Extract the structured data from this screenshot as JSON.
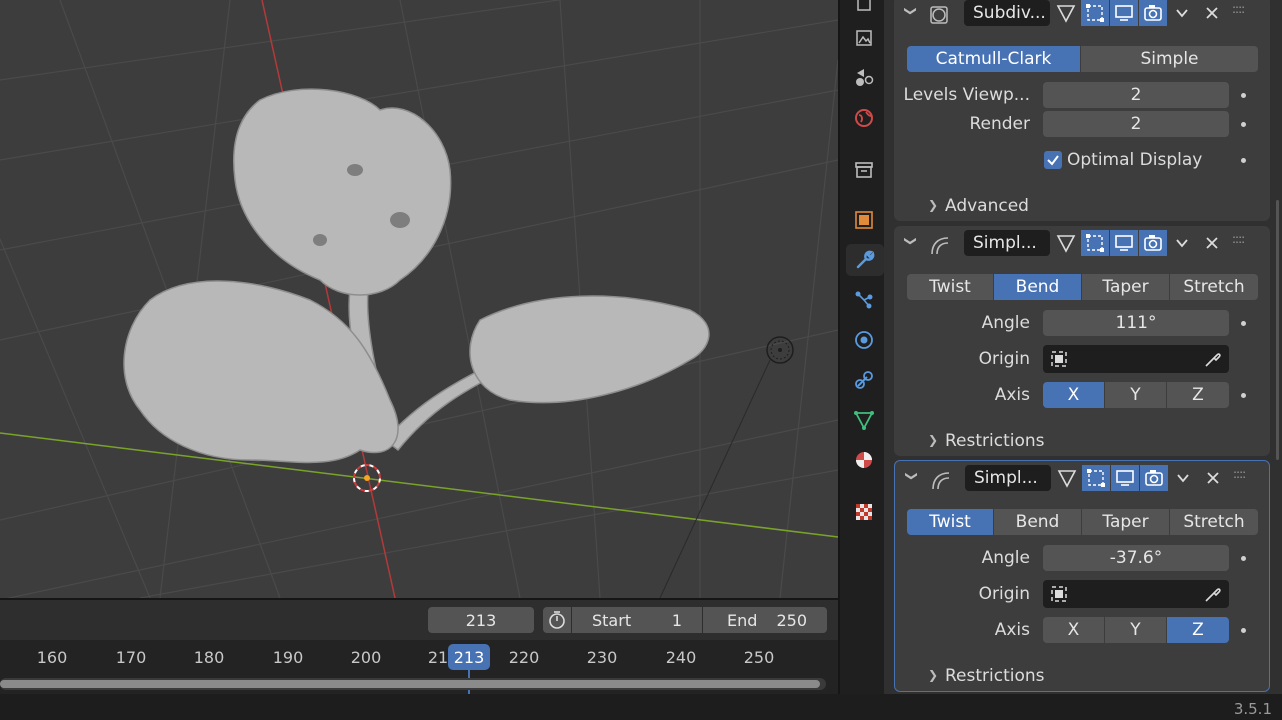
{
  "timeline": {
    "current_frame": "213",
    "start_label": "Start",
    "start_value": "1",
    "end_label": "End",
    "end_value": "250",
    "ruler_ticks": [
      "160",
      "170",
      "180",
      "190",
      "200",
      "21",
      "220",
      "230",
      "240",
      "250"
    ],
    "playhead_frame": "213"
  },
  "status": {
    "version": "3.5.1"
  },
  "tabs": [
    "tool-icon",
    "render-icon",
    "output-icon",
    "view-layer-icon",
    "scene-icon",
    "world-icon",
    "collection-icon",
    "object-icon",
    "modifier-icon",
    "particles-icon",
    "physics-icon",
    "constraints-icon",
    "object-data-icon",
    "material-icon",
    "texture-icon"
  ],
  "modifiers": [
    {
      "name": "Subdiv...",
      "type_options": [
        "Catmull-Clark",
        "Simple"
      ],
      "selected_type": "Catmull-Clark",
      "levels_viewport_label": "Levels Viewp...",
      "levels_viewport": "2",
      "render_label": "Render",
      "render": "2",
      "optimal_display_label": "Optimal Display",
      "optimal_display": true,
      "advanced_label": "Advanced"
    },
    {
      "name": "Simpl...",
      "modes": [
        "Twist",
        "Bend",
        "Taper",
        "Stretch"
      ],
      "selected_mode": "Bend",
      "angle_label": "Angle",
      "angle": "111°",
      "origin_label": "Origin",
      "axis_label": "Axis",
      "axes": [
        "X",
        "Y",
        "Z"
      ],
      "selected_axis": "X",
      "restrictions_label": "Restrictions"
    },
    {
      "name": "Simpl...",
      "modes": [
        "Twist",
        "Bend",
        "Taper",
        "Stretch"
      ],
      "selected_mode": "Twist",
      "angle_label": "Angle",
      "angle": "-37.6°",
      "origin_label": "Origin",
      "axis_label": "Axis",
      "axes": [
        "X",
        "Y",
        "Z"
      ],
      "selected_axis": "Z",
      "restrictions_label": "Restrictions"
    }
  ],
  "colors": {
    "accent": "#4772b3",
    "x_axis": "#b33a3a",
    "y_axis": "#7aa32a"
  }
}
